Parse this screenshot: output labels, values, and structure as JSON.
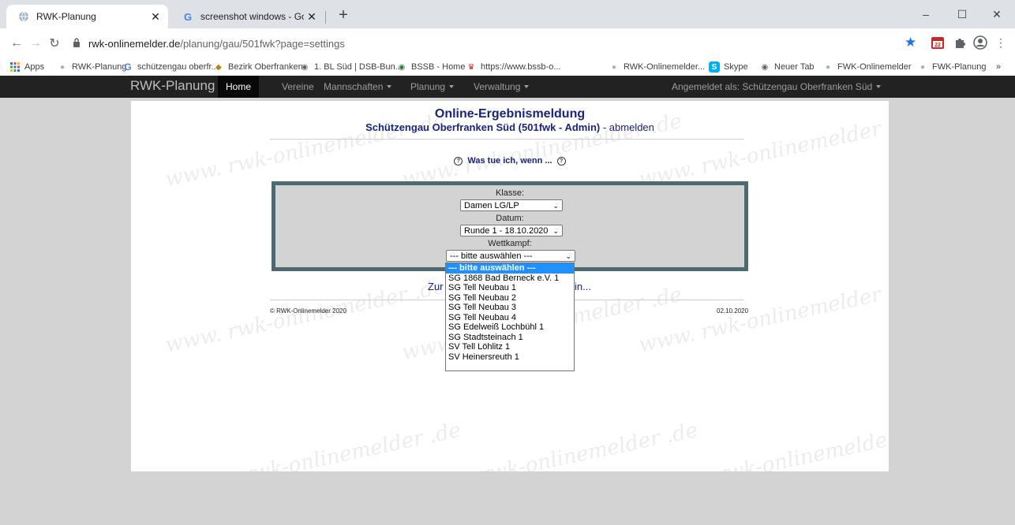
{
  "browser": {
    "tabs": [
      {
        "title": "RWK-Planung",
        "active": true
      },
      {
        "title": "screenshot windows - Google Su",
        "active": false
      }
    ],
    "new_tab_label": "+",
    "url": {
      "host": "rwk-onlinemelder.de",
      "path": "/planung/gau/501fwk?page=settings"
    },
    "window_controls": {
      "minimize": "–",
      "maximize": "☐",
      "close": "✕"
    },
    "ext_badge": "22",
    "bookmarks": [
      "Apps",
      "RWK-Planung",
      "schützengau oberfr...",
      "Bezirk Oberfranken",
      "1. BL Süd | DSB-Bun...",
      "BSSB - Home",
      "https://www.bssb-o...",
      "RWK-Onlinemelder...",
      "Skype",
      "Neuer Tab",
      "FWK-Onlinemelder",
      "FWK-Planung"
    ],
    "bookmarks_more": "»"
  },
  "nav": {
    "brand": "RWK-Planung",
    "items": [
      "Home",
      "Vereine",
      "Mannschaften",
      "Planung",
      "Verwaltung"
    ],
    "user": "Angemeldet als: Schützengau Oberfranken Süd"
  },
  "content": {
    "watermark": "www. rwk-onlinemelder .de",
    "title": "Online-Ergebnismeldung",
    "subtitle_bold": "Schützengau Oberfranken Süd (501fwk - Admin)",
    "subtitle_sep": " - ",
    "logout": "abmelden",
    "help": "Was tue ich, wenn ...",
    "klasse_label": "Klasse:",
    "klasse_value": "Damen LG/LP",
    "datum_label": "Datum:",
    "datum_value": "Runde 1 - 18.10.2020",
    "wettkampf_label": "Wettkampf:",
    "wettkampf_value": "--- bitte auswählen ---",
    "wettkampf_options": [
      "--- bitte auswählen ---",
      "SG 1868 Bad Berneck e.V. 1",
      "SG Tell Neubau 1",
      "SG Tell Neubau 2",
      "SG Tell Neubau 3",
      "SG Tell Neubau 4",
      "SG Edelweiß Lochbühl 1",
      "SG Stadtsteinach 1",
      "SV Tell Löhlitz 1",
      "SV Heinersreuth 1"
    ],
    "back_left": "Zur",
    "back_right": "in...",
    "copyright": "© RWK-Onlinemelder 2020",
    "date": "02.10.2020"
  }
}
